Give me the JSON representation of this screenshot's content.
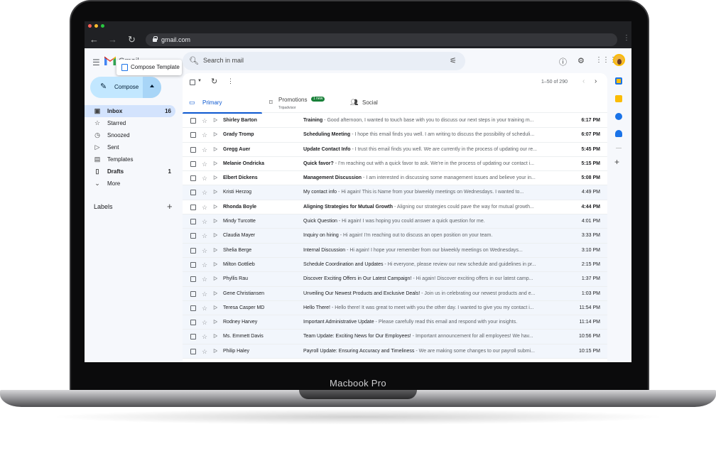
{
  "device": {
    "label": "Macbook Pro"
  },
  "browser": {
    "url": "gmail.com"
  },
  "app": {
    "logo_text": "Gmail"
  },
  "tooltip": {
    "text": "Compose Template"
  },
  "search": {
    "placeholder": "Search in mail"
  },
  "compose": {
    "label": "Compose"
  },
  "nav": {
    "items": [
      {
        "icon": "inbox-icon",
        "glyph": "▣",
        "label": "Inbox",
        "count": "16",
        "active": true
      },
      {
        "icon": "star-icon",
        "glyph": "☆",
        "label": "Starred",
        "count": ""
      },
      {
        "icon": "clock-icon",
        "glyph": "◷",
        "label": "Snoozed",
        "count": ""
      },
      {
        "icon": "send-icon",
        "glyph": "▷",
        "label": "Sent",
        "count": ""
      },
      {
        "icon": "template-icon",
        "glyph": "▤",
        "label": "Templates",
        "count": ""
      },
      {
        "icon": "draft-icon",
        "glyph": "▯",
        "label": "Drafts",
        "count": "1",
        "bold": true
      },
      {
        "icon": "chevron-down-icon",
        "glyph": "⌄",
        "label": "More",
        "count": ""
      }
    ],
    "labels_heading": "Labels"
  },
  "toolbar": {
    "pager": "1–50 of 290"
  },
  "tabs": {
    "primary": "Primary",
    "promotions": "Promotions",
    "promotions_badge": "1 new",
    "promotions_sub": "Tripadvisor",
    "social": "Social"
  },
  "emails": [
    {
      "sender": "Shirley Barton",
      "subject": "Training",
      "snippet": "Good afternoon, I wanted to touch base with you to discuss our next steps in your training m...",
      "time": "6:17 PM",
      "unread": true
    },
    {
      "sender": "Grady Tromp",
      "subject": "Scheduling Meeting",
      "snippet": "I hope this email finds you well. I am writing to discuss the possibility of scheduli...",
      "time": "6:07 PM",
      "unread": true
    },
    {
      "sender": "Gregg Auer",
      "subject": "Update Contact Info",
      "snippet": "I trust this email finds you well. We are currently in the process of updating our re...",
      "time": "5:45 PM",
      "unread": true
    },
    {
      "sender": "Melanie Ondricka",
      "subject": "Quick favor?",
      "snippet": "I'm reaching out with a quick favor to ask. We're in the process of updating our contact i...",
      "time": "5:15 PM",
      "unread": true
    },
    {
      "sender": "Elbert Dickens",
      "subject": "Management Discussion",
      "snippet": "I am interested in discussing some management issues and believe your in...",
      "time": "5:08 PM",
      "unread": true
    },
    {
      "sender": "Kristi Herzog",
      "subject": "My contact info",
      "snippet": "Hi again! This is Name from your biweekly meetings on Wednesdays. I wanted to...",
      "time": "4:49 PM",
      "unread": false
    },
    {
      "sender": "Rhonda Boyle",
      "subject": "Aligning Strategies for Mutual Growth",
      "snippet": "Aligning our strategies could pave the way for mutual growth...",
      "time": "4:44 PM",
      "unread": true
    },
    {
      "sender": "Mindy Turcotte",
      "subject": "Quick Question",
      "snippet": "Hi again! I was hoping you could answer a quick question for me.",
      "time": "4:01 PM",
      "unread": false
    },
    {
      "sender": "Claudia Mayer",
      "subject": "Inquiry on hiring",
      "snippet": "Hi again! I'm reaching out to discuss an open position on your team.",
      "time": "3:33 PM",
      "unread": false
    },
    {
      "sender": "Shelia Berge",
      "subject": "Internal Discussion",
      "snippet": "Hi again! I hope your remember from our biweekly meetings on Wednesdays...",
      "time": "3:10 PM",
      "unread": false
    },
    {
      "sender": "Milton Gottlieb",
      "subject": "Schedule Coordination and Updates",
      "snippet": "Hi everyone, please review our new schedule and guidelines in pr...",
      "time": "2:15 PM",
      "unread": false
    },
    {
      "sender": "Phyllis Rau",
      "subject": "Discover Exciting Offers in Our Latest Campaign!",
      "snippet": "Hi again! Discover exciting offers in our latest camp...",
      "time": "1:37 PM",
      "unread": false
    },
    {
      "sender": "Gene Christiansen",
      "subject": "Unveiling Our Newest Products and Exclusive Deals!",
      "snippet": "Join us in celebrating our newest products and e...",
      "time": "1:03 PM",
      "unread": false
    },
    {
      "sender": "Teresa Casper MD",
      "subject": "Hello There!",
      "snippet": "Hello there! It was great to meet with you the other day. I wanted to give you my contact i...",
      "time": "11:54 PM",
      "unread": false
    },
    {
      "sender": "Rodney Harvey",
      "subject": "Important Administrative Update",
      "snippet": "Please carefully read this email and respond with your insights.",
      "time": "11:14 PM",
      "unread": false
    },
    {
      "sender": "Ms. Emmett Davis",
      "subject": "Team Update: Exciting News for Our Employees!",
      "snippet": "Important announcement for all employees! We hav...",
      "time": "10:56 PM",
      "unread": false
    },
    {
      "sender": "Philip Haley",
      "subject": "Payroll Update: Ensuring Accuracy and Timeliness",
      "snippet": "We are making some changes to our payroll submi...",
      "time": "10:15 PM",
      "unread": false
    }
  ],
  "colors": {
    "accent": "#0b57d0",
    "compose_bg": "#c2e7ff",
    "nav_active": "#d3e3fd",
    "read_row": "#f2f6fc"
  }
}
